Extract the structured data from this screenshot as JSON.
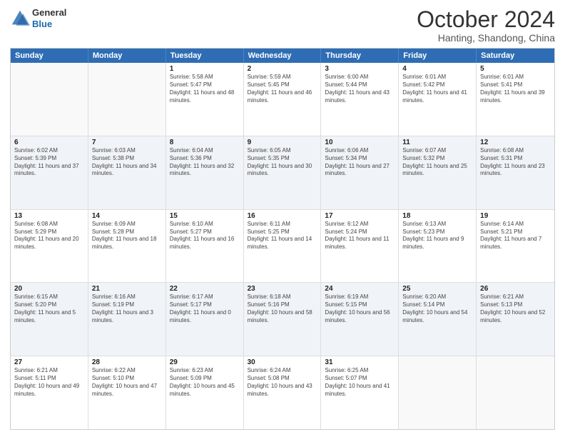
{
  "header": {
    "logo_general": "General",
    "logo_blue": "Blue",
    "month_title": "October 2024",
    "location": "Hanting, Shandong, China"
  },
  "calendar": {
    "days_of_week": [
      "Sunday",
      "Monday",
      "Tuesday",
      "Wednesday",
      "Thursday",
      "Friday",
      "Saturday"
    ],
    "rows": [
      [
        {
          "day": "",
          "text": ""
        },
        {
          "day": "",
          "text": ""
        },
        {
          "day": "1",
          "text": "Sunrise: 5:58 AM\nSunset: 5:47 PM\nDaylight: 11 hours and 48 minutes."
        },
        {
          "day": "2",
          "text": "Sunrise: 5:59 AM\nSunset: 5:45 PM\nDaylight: 11 hours and 46 minutes."
        },
        {
          "day": "3",
          "text": "Sunrise: 6:00 AM\nSunset: 5:44 PM\nDaylight: 11 hours and 43 minutes."
        },
        {
          "day": "4",
          "text": "Sunrise: 6:01 AM\nSunset: 5:42 PM\nDaylight: 11 hours and 41 minutes."
        },
        {
          "day": "5",
          "text": "Sunrise: 6:01 AM\nSunset: 5:41 PM\nDaylight: 11 hours and 39 minutes."
        }
      ],
      [
        {
          "day": "6",
          "text": "Sunrise: 6:02 AM\nSunset: 5:39 PM\nDaylight: 11 hours and 37 minutes."
        },
        {
          "day": "7",
          "text": "Sunrise: 6:03 AM\nSunset: 5:38 PM\nDaylight: 11 hours and 34 minutes."
        },
        {
          "day": "8",
          "text": "Sunrise: 6:04 AM\nSunset: 5:36 PM\nDaylight: 11 hours and 32 minutes."
        },
        {
          "day": "9",
          "text": "Sunrise: 6:05 AM\nSunset: 5:35 PM\nDaylight: 11 hours and 30 minutes."
        },
        {
          "day": "10",
          "text": "Sunrise: 6:06 AM\nSunset: 5:34 PM\nDaylight: 11 hours and 27 minutes."
        },
        {
          "day": "11",
          "text": "Sunrise: 6:07 AM\nSunset: 5:32 PM\nDaylight: 11 hours and 25 minutes."
        },
        {
          "day": "12",
          "text": "Sunrise: 6:08 AM\nSunset: 5:31 PM\nDaylight: 11 hours and 23 minutes."
        }
      ],
      [
        {
          "day": "13",
          "text": "Sunrise: 6:08 AM\nSunset: 5:29 PM\nDaylight: 11 hours and 20 minutes."
        },
        {
          "day": "14",
          "text": "Sunrise: 6:09 AM\nSunset: 5:28 PM\nDaylight: 11 hours and 18 minutes."
        },
        {
          "day": "15",
          "text": "Sunrise: 6:10 AM\nSunset: 5:27 PM\nDaylight: 11 hours and 16 minutes."
        },
        {
          "day": "16",
          "text": "Sunrise: 6:11 AM\nSunset: 5:25 PM\nDaylight: 11 hours and 14 minutes."
        },
        {
          "day": "17",
          "text": "Sunrise: 6:12 AM\nSunset: 5:24 PM\nDaylight: 11 hours and 11 minutes."
        },
        {
          "day": "18",
          "text": "Sunrise: 6:13 AM\nSunset: 5:23 PM\nDaylight: 11 hours and 9 minutes."
        },
        {
          "day": "19",
          "text": "Sunrise: 6:14 AM\nSunset: 5:21 PM\nDaylight: 11 hours and 7 minutes."
        }
      ],
      [
        {
          "day": "20",
          "text": "Sunrise: 6:15 AM\nSunset: 5:20 PM\nDaylight: 11 hours and 5 minutes."
        },
        {
          "day": "21",
          "text": "Sunrise: 6:16 AM\nSunset: 5:19 PM\nDaylight: 11 hours and 3 minutes."
        },
        {
          "day": "22",
          "text": "Sunrise: 6:17 AM\nSunset: 5:17 PM\nDaylight: 11 hours and 0 minutes."
        },
        {
          "day": "23",
          "text": "Sunrise: 6:18 AM\nSunset: 5:16 PM\nDaylight: 10 hours and 58 minutes."
        },
        {
          "day": "24",
          "text": "Sunrise: 6:19 AM\nSunset: 5:15 PM\nDaylight: 10 hours and 56 minutes."
        },
        {
          "day": "25",
          "text": "Sunrise: 6:20 AM\nSunset: 5:14 PM\nDaylight: 10 hours and 54 minutes."
        },
        {
          "day": "26",
          "text": "Sunrise: 6:21 AM\nSunset: 5:13 PM\nDaylight: 10 hours and 52 minutes."
        }
      ],
      [
        {
          "day": "27",
          "text": "Sunrise: 6:21 AM\nSunset: 5:11 PM\nDaylight: 10 hours and 49 minutes."
        },
        {
          "day": "28",
          "text": "Sunrise: 6:22 AM\nSunset: 5:10 PM\nDaylight: 10 hours and 47 minutes."
        },
        {
          "day": "29",
          "text": "Sunrise: 6:23 AM\nSunset: 5:09 PM\nDaylight: 10 hours and 45 minutes."
        },
        {
          "day": "30",
          "text": "Sunrise: 6:24 AM\nSunset: 5:08 PM\nDaylight: 10 hours and 43 minutes."
        },
        {
          "day": "31",
          "text": "Sunrise: 6:25 AM\nSunset: 5:07 PM\nDaylight: 10 hours and 41 minutes."
        },
        {
          "day": "",
          "text": ""
        },
        {
          "day": "",
          "text": ""
        }
      ]
    ]
  }
}
